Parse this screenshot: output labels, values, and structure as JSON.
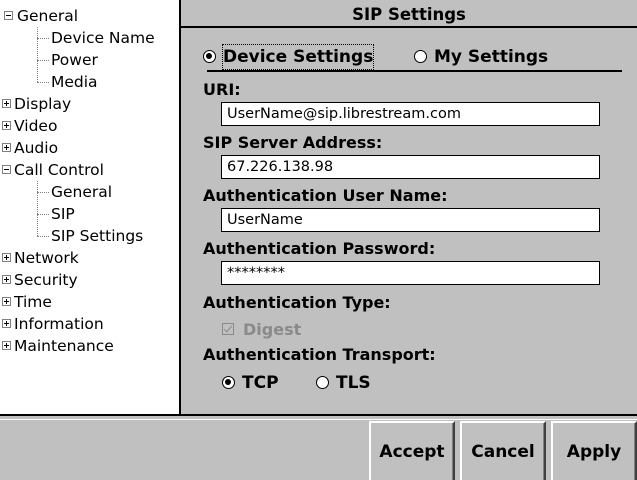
{
  "tree": {
    "general": "General",
    "device_name": "Device Name",
    "power": "Power",
    "media": "Media",
    "display": "Display",
    "video": "Video",
    "audio": "Audio",
    "call_control": "Call Control",
    "cc_general": "General",
    "sip": "SIP",
    "sip_settings": "SIP Settings",
    "network": "Network",
    "security": "Security",
    "time": "Time",
    "information": "Information",
    "maintenance": "Maintenance"
  },
  "panel": {
    "title": "SIP Settings",
    "mode": {
      "device_settings": "Device Settings",
      "my_settings": "My Settings",
      "selected": "device_settings"
    },
    "uri": {
      "label": "URI:",
      "value": "UserName@sip.librestream.com"
    },
    "server": {
      "label": "SIP Server Address:",
      "value": "67.226.138.98"
    },
    "auth_user": {
      "label": "Authentication User Name:",
      "value": "UserName"
    },
    "auth_pass": {
      "label": "Authentication Password:",
      "value": "********"
    },
    "auth_type": {
      "label": "Authentication Type:",
      "digest": "Digest",
      "digest_checked": true,
      "digest_enabled": false
    },
    "transport": {
      "label": "Authentication Transport:",
      "tcp": "TCP",
      "tls": "TLS",
      "selected": "TCP"
    }
  },
  "buttons": {
    "accept": "Accept",
    "cancel": "Cancel",
    "apply": "Apply"
  }
}
